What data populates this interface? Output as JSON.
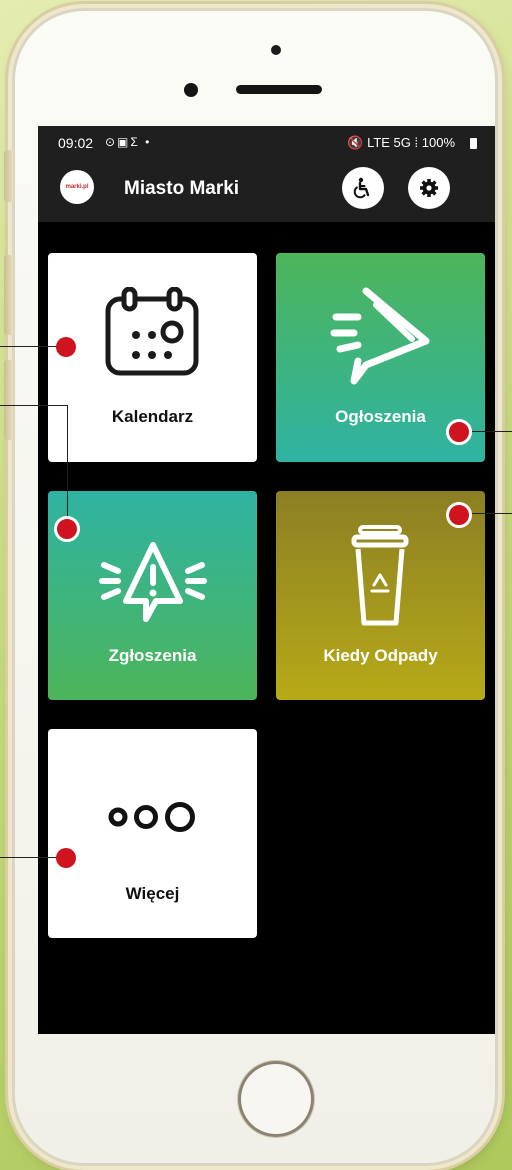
{
  "status_bar": {
    "time": "09:02",
    "left_icons": "⊙▣Σ •",
    "right_icons": "🔇 LTE 5G ⁞",
    "battery": "100%"
  },
  "app_bar": {
    "logo_text": "marki.pl",
    "title": "Miasto Marki",
    "accessibility_icon": "wheelchair-icon",
    "settings_icon": "gear-icon"
  },
  "tiles": [
    {
      "label": "Kalendarz",
      "icon": "calendar-icon",
      "background": "#ffffff",
      "text_color": "#111111"
    },
    {
      "label": "Ogłoszenia",
      "icon": "megaphone-icon",
      "background": "#3fb38a",
      "text_color": "#ffffff"
    },
    {
      "label": "Zgłoszenia",
      "icon": "alert-icon",
      "background": "#3fb38a",
      "text_color": "#ffffff"
    },
    {
      "label": "Kiedy Odpady",
      "icon": "recycle-bin-icon",
      "background": "#a29a22",
      "text_color": "#ffffff"
    },
    {
      "label": "Więcej",
      "icon": "more-dots-icon",
      "background": "#ffffff",
      "text_color": "#111111"
    }
  ],
  "colors": {
    "accent_green_top": "#4db55a",
    "accent_green_bottom": "#2fb3a2",
    "accent_olive_top": "#8c7f24",
    "accent_olive_bottom": "#b6aa18",
    "marker_red": "#cf1420"
  }
}
